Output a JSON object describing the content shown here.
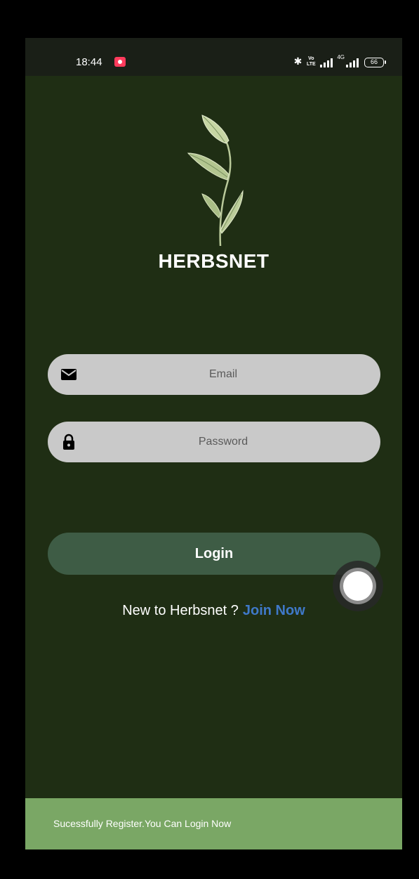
{
  "status_bar": {
    "time": "18:44",
    "network_label": "4G",
    "battery": "66"
  },
  "app": {
    "title": "HERBSNET"
  },
  "form": {
    "email_placeholder": "Email",
    "password_placeholder": "Password",
    "login_label": "Login"
  },
  "signup": {
    "prompt": "New to Herbsnet ?",
    "link": "Join Now"
  },
  "snackbar": {
    "message": "Sucessfully Register.You Can Login Now"
  },
  "colors": {
    "background": "#1f2e14",
    "field": "#c9c9c9",
    "button": "#3e5c45",
    "link": "#3f79c9",
    "snackbar": "#7aa765"
  },
  "icons": {
    "email": "envelope-icon",
    "password": "lock-icon"
  }
}
